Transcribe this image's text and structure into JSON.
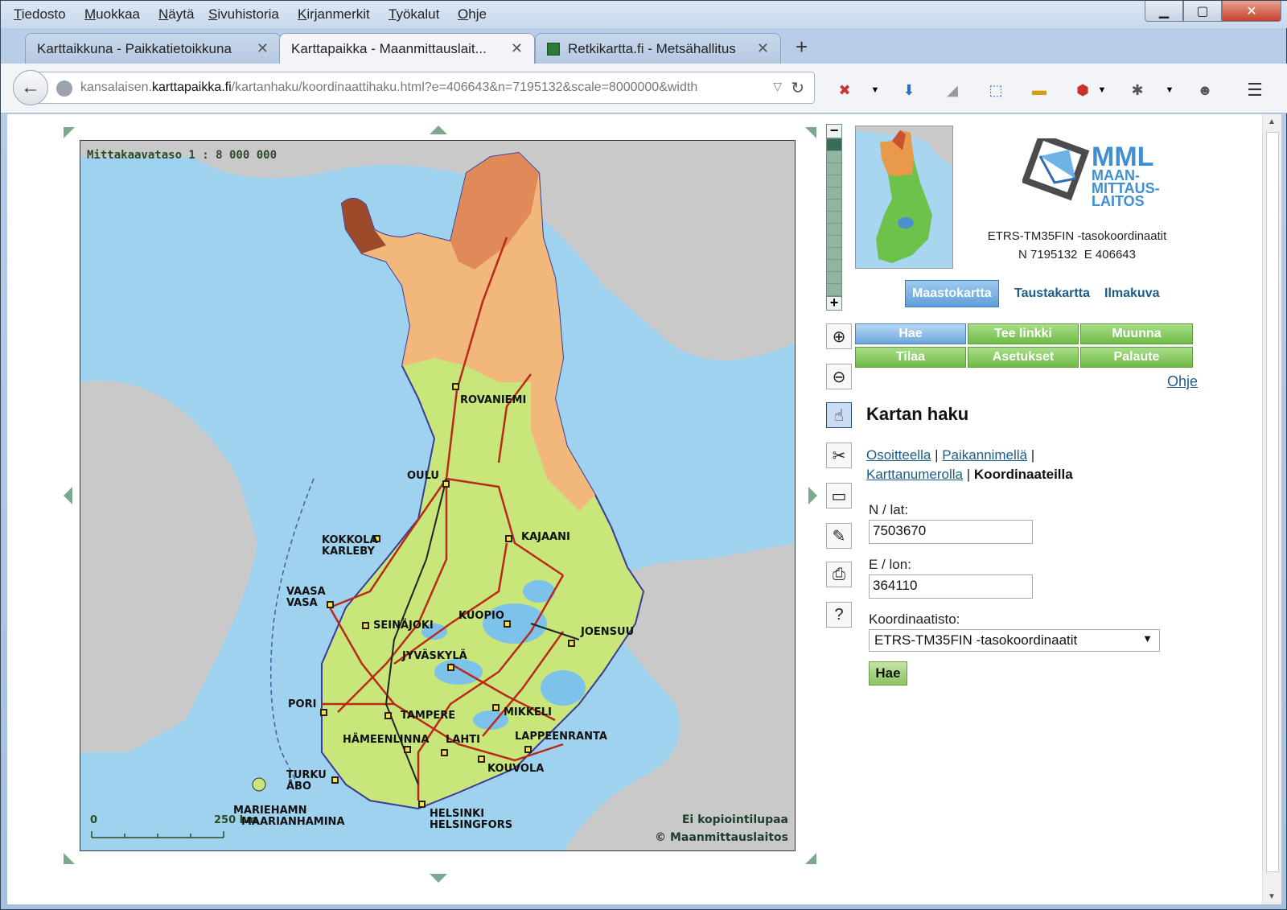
{
  "menubar": {
    "items": [
      "Tiedosto",
      "Muokkaa",
      "Näytä",
      "Sivuhistoria",
      "Kirjanmerkit",
      "Työkalut",
      "Ohje"
    ]
  },
  "tabs": [
    {
      "label": "Karttaikkuna - Paikkatietoikkuna",
      "active": false
    },
    {
      "label": "Karttapaikka - Maanmittauslait...",
      "active": true
    },
    {
      "label": "Retkikartta.fi - Metsähallitus",
      "active": false
    }
  ],
  "url": {
    "prefix": "kansalaisen.",
    "host": "karttapaikka.fi",
    "path": "/kartanhaku/koordinaattihaku.html?e=406643&n=7195132&scale=8000000&width"
  },
  "map": {
    "scale_label": "Mittakaavataso 1 : 8 000 000",
    "copy_line1": "Ei kopiointilupaa",
    "copy_line2": "© Maanmittauslaitos",
    "scalebar_zero": "0",
    "scalebar_km": "250 km",
    "cities": [
      {
        "name": "ROVANIEMI"
      },
      {
        "name": "OULU"
      },
      {
        "name": "KOKKOLA"
      },
      {
        "name": "KARLEBY"
      },
      {
        "name": "KAJAANI"
      },
      {
        "name": "VAASA"
      },
      {
        "name": "VASA"
      },
      {
        "name": "SEINÄJOKI"
      },
      {
        "name": "KUOPIO"
      },
      {
        "name": "JOENSUU"
      },
      {
        "name": "JYVÄSKYLÄ"
      },
      {
        "name": "PORI"
      },
      {
        "name": "TAMPERE"
      },
      {
        "name": "MIKKELI"
      },
      {
        "name": "HÄMEENLINNA"
      },
      {
        "name": "LAHTI"
      },
      {
        "name": "LAPPEENRANTA"
      },
      {
        "name": "TURKU"
      },
      {
        "name": "ÅBO"
      },
      {
        "name": "KOUVOLA"
      },
      {
        "name": "MARIEHAMN"
      },
      {
        "name": "MAARIANHAMINA"
      },
      {
        "name": "HELSINKI"
      },
      {
        "name": "HELSINGFORS"
      }
    ]
  },
  "logo": {
    "line1": "MML",
    "line2": "MAAN-",
    "line3": "MITTAUS-",
    "line4": "LAITOS"
  },
  "coords": {
    "label": "ETRS-TM35FIN -tasokoordinaatit",
    "n": "N 7195132",
    "e": "E 406643"
  },
  "layers": {
    "maastokartta": "Maastokartta",
    "taustakartta": "Taustakartta",
    "ilmakuva": "Ilmakuva"
  },
  "buttons": {
    "hae": "Hae",
    "tee_linkki": "Tee linkki",
    "muunna": "Muunna",
    "tilaa": "Tilaa",
    "asetukset": "Asetukset",
    "palaute": "Palaute"
  },
  "help": "Ohje",
  "panel": {
    "title": "Kartan haku",
    "link_osoite": "Osoitteella",
    "link_paikka": "Paikannimellä",
    "link_kartta": "Karttanumerolla",
    "current": "Koordinaateilla",
    "sep": "|"
  },
  "form": {
    "n_label": "N / lat:",
    "n_value": "7503670",
    "e_label": "E / lon:",
    "e_value": "364110",
    "system_label": "Koordinaatisto:",
    "system_value": "ETRS-TM35FIN -tasokoordinaatit",
    "submit": "Hae"
  },
  "colors": {
    "accent_green": "#6fbb46",
    "accent_blue": "#5e9fd6",
    "link": "#1b5d8a",
    "sea": "#9fd2ee",
    "land_foreign": "#c8c8c8"
  }
}
